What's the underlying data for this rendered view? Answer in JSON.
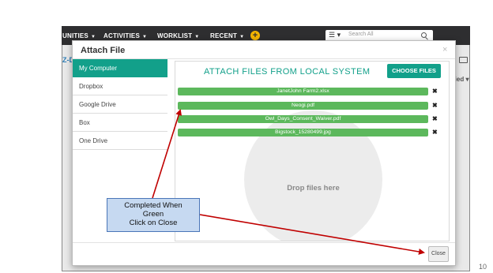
{
  "nav": {
    "items": [
      "UNITIES",
      "ACTIVITIES",
      "WORKLIST",
      "RECENT"
    ],
    "plus_icon": "+",
    "search_menu": "☰ ▾",
    "search_placeholder": "Search All",
    "left_text": "Z-D",
    "right_text": "fied ▾"
  },
  "modal": {
    "title": "Attach File",
    "close_x": "×",
    "sources": [
      {
        "label": "My Computer",
        "active": true
      },
      {
        "label": "Dropbox",
        "active": false
      },
      {
        "label": "Google Drive",
        "active": false
      },
      {
        "label": "Box",
        "active": false
      },
      {
        "label": "One Drive",
        "active": false
      }
    ],
    "heading": "ATTACH FILES FROM LOCAL SYSTEM",
    "choose_button": "CHOOSE FILES",
    "files": [
      {
        "name": "JanetJohn Farm2.xlsx",
        "remove": "✖"
      },
      {
        "name": "Neogi.pdf",
        "remove": "✖"
      },
      {
        "name": "Owl_Days_Consent_Waiver.pdf",
        "remove": "✖"
      },
      {
        "name": "Bigstock_15280499.jpg",
        "remove": "✖"
      }
    ],
    "drop_text": "Drop files here",
    "close_button": "Close"
  },
  "callout": {
    "lines": [
      "Completed When",
      "Green",
      "Click on Close"
    ]
  },
  "page_number": "10",
  "colors": {
    "accent": "#12a08a",
    "file_bar": "#5cb85c",
    "navbar": "#2e2e30",
    "arrow": "#c00000",
    "callout_fill": "#c6d9f1",
    "callout_border": "#4a76b8"
  }
}
